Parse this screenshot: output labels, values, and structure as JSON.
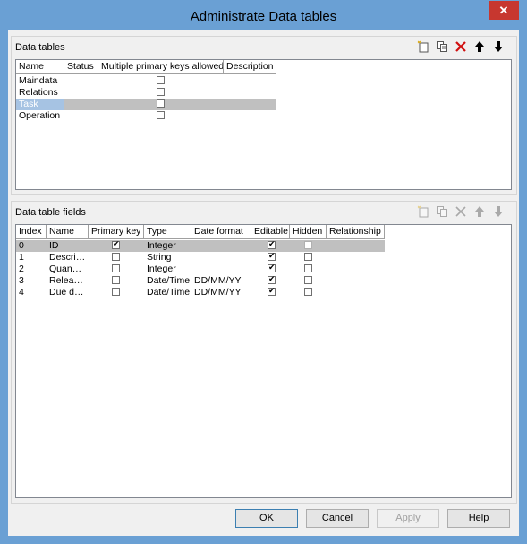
{
  "window": {
    "title": "Administrate Data tables",
    "close_label": "✕"
  },
  "data_tables": {
    "group_title": "Data tables",
    "columns": [
      "Name",
      "Status",
      "Multiple primary keys allowed",
      "Description"
    ],
    "rows": [
      {
        "name": "Maindata",
        "multi_pk": false
      },
      {
        "name": "Relations",
        "multi_pk": false
      },
      {
        "name": "Task",
        "multi_pk": false,
        "selected": true
      },
      {
        "name": "Operation",
        "multi_pk": false
      }
    ]
  },
  "fields": {
    "group_title": "Data table fields",
    "columns": [
      "Index",
      "Name",
      "Primary key",
      "Type",
      "Date format",
      "Editable",
      "Hidden",
      "Relationship"
    ],
    "rows": [
      {
        "index": "0",
        "name": "ID",
        "pk": true,
        "type": "Integer",
        "date_format": "",
        "editable": true,
        "hidden": false,
        "selected": true
      },
      {
        "index": "1",
        "name": "Descri…",
        "pk": false,
        "type": "String",
        "date_format": "",
        "editable": true,
        "hidden": false
      },
      {
        "index": "2",
        "name": "Quan…",
        "pk": false,
        "type": "Integer",
        "date_format": "",
        "editable": true,
        "hidden": false
      },
      {
        "index": "3",
        "name": "Relea…",
        "pk": false,
        "type": "Date/Time",
        "date_format": "DD/MM/YY",
        "editable": true,
        "hidden": false
      },
      {
        "index": "4",
        "name": "Due d…",
        "pk": false,
        "type": "Date/Time",
        "date_format": "DD/MM/YY",
        "editable": true,
        "hidden": false
      }
    ]
  },
  "toolbar_icons": [
    "new-icon",
    "copy-icon",
    "delete-icon",
    "move-up-icon",
    "move-down-icon"
  ],
  "buttons": {
    "ok": "OK",
    "cancel": "Cancel",
    "apply": "Apply",
    "help": "Help"
  }
}
